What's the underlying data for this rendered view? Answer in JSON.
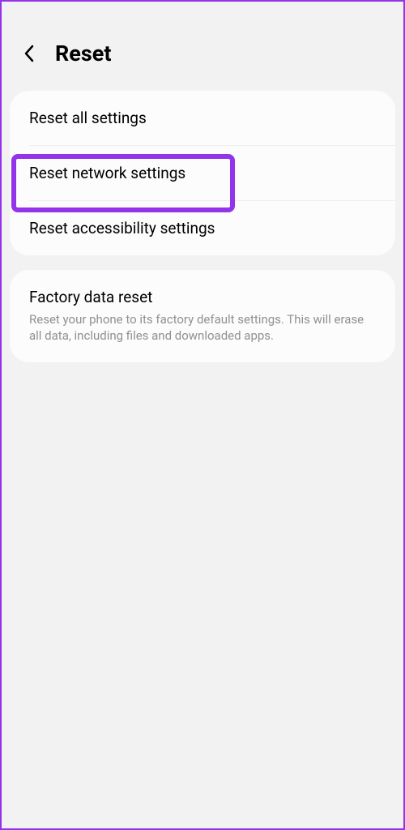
{
  "header": {
    "title": "Reset"
  },
  "group1": {
    "items": [
      {
        "title": "Reset all settings"
      },
      {
        "title": "Reset network settings"
      },
      {
        "title": "Reset accessibility settings"
      }
    ]
  },
  "group2": {
    "items": [
      {
        "title": "Factory data reset",
        "subtitle": "Reset your phone to its factory default settings. This will erase all data, including files and downloaded apps."
      }
    ]
  },
  "colors": {
    "highlight": "#9333ea"
  }
}
